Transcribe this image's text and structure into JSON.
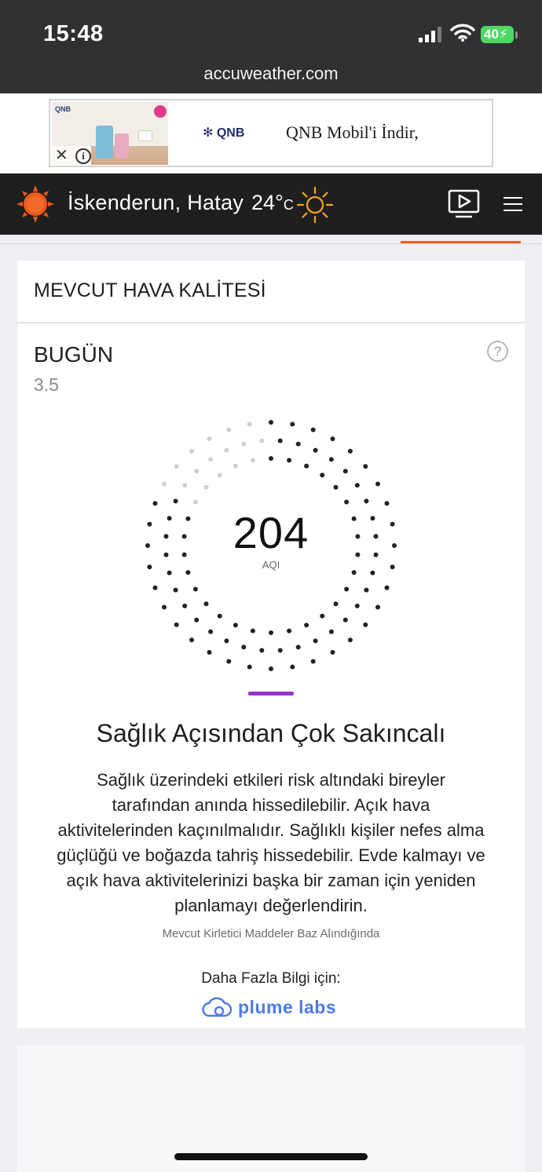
{
  "status_bar": {
    "time": "15:48",
    "battery": "40"
  },
  "browser": {
    "url": "accuweather.com"
  },
  "ad": {
    "brand": "QNB",
    "text": "QNB Mobil'i İndir,",
    "close_icon": "close-icon",
    "info_icon": "info-icon"
  },
  "header": {
    "location": "İskenderun, Hatay",
    "temperature": "24°",
    "temperature_unit": "C",
    "weather_icon": "sunny-icon",
    "accent_color": "#f0581e"
  },
  "air_quality": {
    "title": "MEVCUT HAVA KALİTESİ",
    "day_label": "BUGÜN",
    "day_value": "3.5",
    "aqi": "204",
    "aqi_unit": "AQI",
    "aqi_max": 500,
    "category": "Sağlık Açısından Çok Sakıncalı",
    "category_color": "#9d34c9",
    "description": "Sağlık üzerindeki etkileri risk altındaki bireyler tarafından anında hissedilebilir. Açık hava aktivitelerinden kaçınılmalıdır. Sağlıklı kişiler nefes alma güçlüğü ve boğazda tahriş hissedebilir. Evde kalmayı ve açık hava aktivitelerinizi başka bir zaman için yeniden planlamayı değerlendirin.",
    "basis": "Mevcut Kirletici Maddeler Baz Alındığında",
    "more_info": "Daha Fazla Bilgi için:",
    "partner": "plume labs"
  }
}
